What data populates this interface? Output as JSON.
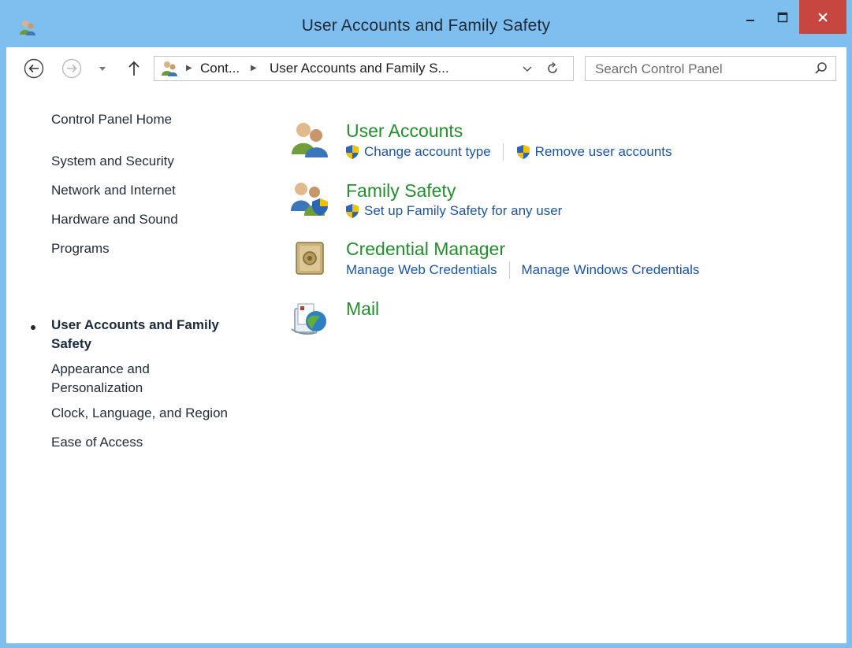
{
  "window": {
    "title": "User Accounts and Family Safety",
    "close_color": "#c7463f",
    "frame_color": "#7fbfef"
  },
  "navigation": {
    "address": {
      "icon": "user-accounts-icon",
      "segments": [
        "Cont...",
        "User Accounts and Family S..."
      ]
    },
    "search": {
      "placeholder": "Search Control Panel"
    }
  },
  "sidebar": {
    "items": [
      {
        "label": "Control Panel Home",
        "active": false
      },
      {
        "label": "System and Security",
        "active": false
      },
      {
        "label": "Network and Internet",
        "active": false
      },
      {
        "label": "Hardware and Sound",
        "active": false
      },
      {
        "label": "Programs",
        "active": false
      },
      {
        "label": "User Accounts and Family Safety",
        "active": true
      },
      {
        "label": "Appearance and Personalization",
        "active": false
      },
      {
        "label": "Clock, Language, and Region",
        "active": false
      },
      {
        "label": "Ease of Access",
        "active": false
      }
    ]
  },
  "categories": [
    {
      "title": "User Accounts",
      "icon": "user-accounts-icon",
      "links": [
        {
          "label": "Change account type",
          "shield": true
        },
        {
          "label": "Remove user accounts",
          "shield": true
        }
      ]
    },
    {
      "title": "Family Safety",
      "icon": "family-safety-icon",
      "links": [
        {
          "label": "Set up Family Safety for any user",
          "shield": true
        }
      ]
    },
    {
      "title": "Credential Manager",
      "icon": "credential-vault-icon",
      "links": [
        {
          "label": "Manage Web Credentials",
          "shield": false
        },
        {
          "label": "Manage Windows Credentials",
          "shield": false
        }
      ]
    },
    {
      "title": "Mail",
      "icon": "mail-icon",
      "links": []
    }
  ],
  "colors": {
    "category_title": "#238e2c",
    "link": "#1b55a5"
  }
}
